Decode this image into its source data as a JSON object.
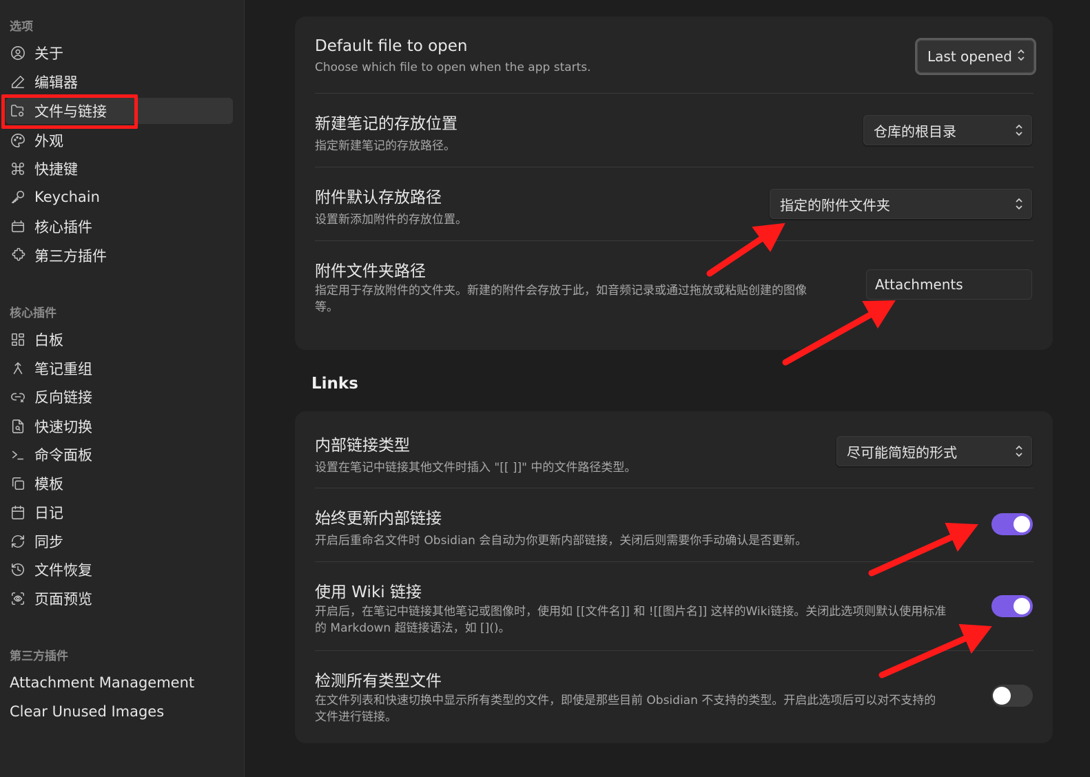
{
  "sidebar": {
    "options_title": "选项",
    "options": [
      {
        "label": "关于",
        "icon": "user-circle-icon"
      },
      {
        "label": "编辑器",
        "icon": "pencil-icon"
      },
      {
        "label": "文件与链接",
        "icon": "folder-cog-icon"
      },
      {
        "label": "外观",
        "icon": "palette-icon"
      },
      {
        "label": "快捷键",
        "icon": "command-icon"
      },
      {
        "label": "Keychain",
        "icon": "key-icon"
      },
      {
        "label": "核心插件",
        "icon": "plugin-box-icon"
      },
      {
        "label": "第三方插件",
        "icon": "puzzle-icon"
      }
    ],
    "core_title": "核心插件",
    "core_plugins": [
      {
        "label": "白板",
        "icon": "layout-grid-icon"
      },
      {
        "label": "笔记重组",
        "icon": "merge-icon"
      },
      {
        "label": "反向链接",
        "icon": "backlink-icon"
      },
      {
        "label": "快速切换",
        "icon": "file-search-icon"
      },
      {
        "label": "命令面板",
        "icon": "terminal-icon"
      },
      {
        "label": "模板",
        "icon": "copy-icon"
      },
      {
        "label": "日记",
        "icon": "calendar-icon"
      },
      {
        "label": "同步",
        "icon": "refresh-icon"
      },
      {
        "label": "文件恢复",
        "icon": "history-icon"
      },
      {
        "label": "页面预览",
        "icon": "scan-eye-icon"
      }
    ],
    "third_title": "第三方插件",
    "third_plugins": [
      {
        "label": "Attachment Management"
      },
      {
        "label": "Clear Unused Images"
      }
    ],
    "active_item": "文件与链接"
  },
  "files": {
    "default_file": {
      "title": "Default file to open",
      "desc": "Choose which file to open when the app starts.",
      "value": "Last opened"
    },
    "new_note_location": {
      "title": "新建笔记的存放位置",
      "desc": "指定新建笔记的存放路径。",
      "value": "仓库的根目录"
    },
    "attachment_default": {
      "title": "附件默认存放路径",
      "desc": "设置新添加附件的存放位置。",
      "value": "指定的附件文件夹"
    },
    "attachment_folder": {
      "title": "附件文件夹路径",
      "desc_line1": "指定用于存放附件的文件夹。新建的附件会存放于此，如音频记录或通过拖放或粘贴创建的图像",
      "desc_line2": "等。",
      "value": "Attachments"
    }
  },
  "links": {
    "heading": "Links",
    "link_format": {
      "title": "内部链接类型",
      "desc": "设置在笔记中链接其他文件时插入 \"[[ ]]\" 中的文件路径类型。",
      "value": "尽可能简短的形式"
    },
    "auto_update": {
      "title": "始终更新内部链接",
      "desc": "开启后重命名文件时 Obsidian 会自动为你更新内部链接，关闭后则需要你手动确认是否更新。",
      "on": true
    },
    "wiki_links": {
      "title": "使用 Wiki 链接",
      "desc_line1": "开启后，在笔记中链接其他笔记或图像时，使用如 [[文件名]] 和 ![[图片名]] 这样的Wiki链接。关闭此选项则默认使用标准",
      "desc_line2": "的 Markdown 超链接语法，如 []()。",
      "on": true
    },
    "detect_all": {
      "title": "检测所有类型文件",
      "desc_line1": "在文件列表和快速切换中显示所有类型的文件，即使是那些目前 Obsidian 不支持的类型。开启此选项后可以对不支持的",
      "desc_line2": "文件进行链接。",
      "on": false
    }
  },
  "colors": {
    "accent": "#7c5ce6",
    "annotation": "#ff1a1a"
  }
}
